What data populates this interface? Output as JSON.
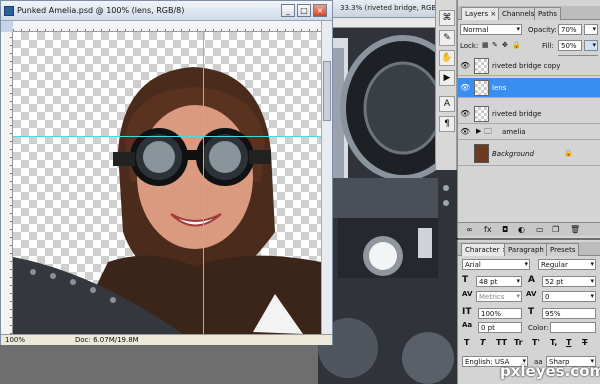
{
  "document": {
    "title": "Punked Amelia.psd @ 100% (lens, RGB/8)",
    "zoom": "100%",
    "doc_info": "Doc: 6.07M/19.8M"
  },
  "background_document": {
    "title": "33.3% (riveted bridge, RGB/8)"
  },
  "layers_panel": {
    "tabs": [
      "Layers",
      "Channels",
      "Paths"
    ],
    "blend_mode": "Normal",
    "opacity_label": "Opacity:",
    "opacity_value": "70%",
    "lock_label": "Lock:",
    "fill_label": "Fill:",
    "fill_value": "50%",
    "layers": [
      {
        "name": "riveted bridge copy",
        "selected": false,
        "visible": true
      },
      {
        "name": "lens",
        "selected": true,
        "visible": true
      },
      {
        "name": "riveted bridge",
        "selected": false,
        "visible": true
      },
      {
        "name": "amelia",
        "selected": false,
        "visible": true,
        "group": true
      },
      {
        "name": "Background",
        "selected": false,
        "visible": false,
        "locked": true
      }
    ],
    "footer_icons": [
      "link-icon",
      "fx-icon",
      "mask-icon",
      "adjustment-icon",
      "folder-icon",
      "new-layer-icon",
      "trash-icon"
    ]
  },
  "character_panel": {
    "tabs": [
      "Character",
      "Paragraph",
      "Presets"
    ],
    "font_family": "Arial",
    "font_style": "Regular",
    "font_size": "48 pt",
    "leading": "52 pt",
    "kerning": "Metrics",
    "tracking": "0",
    "vertical_scale": "100%",
    "horizontal_scale": "95%",
    "baseline_shift": "0 pt",
    "color_label": "Color:",
    "style_buttons": [
      "T",
      "T",
      "TT",
      "Tr",
      "T'",
      "T,",
      "T",
      "T"
    ],
    "language": "English: USA",
    "aa_label": "aa",
    "antialias": "Sharp"
  },
  "watermark": "pxleyes.com",
  "colors": {
    "selection_blue": "#3a8ef0",
    "guide_cyan": "#49d6e6",
    "titlebar": "#cfdbe9"
  }
}
